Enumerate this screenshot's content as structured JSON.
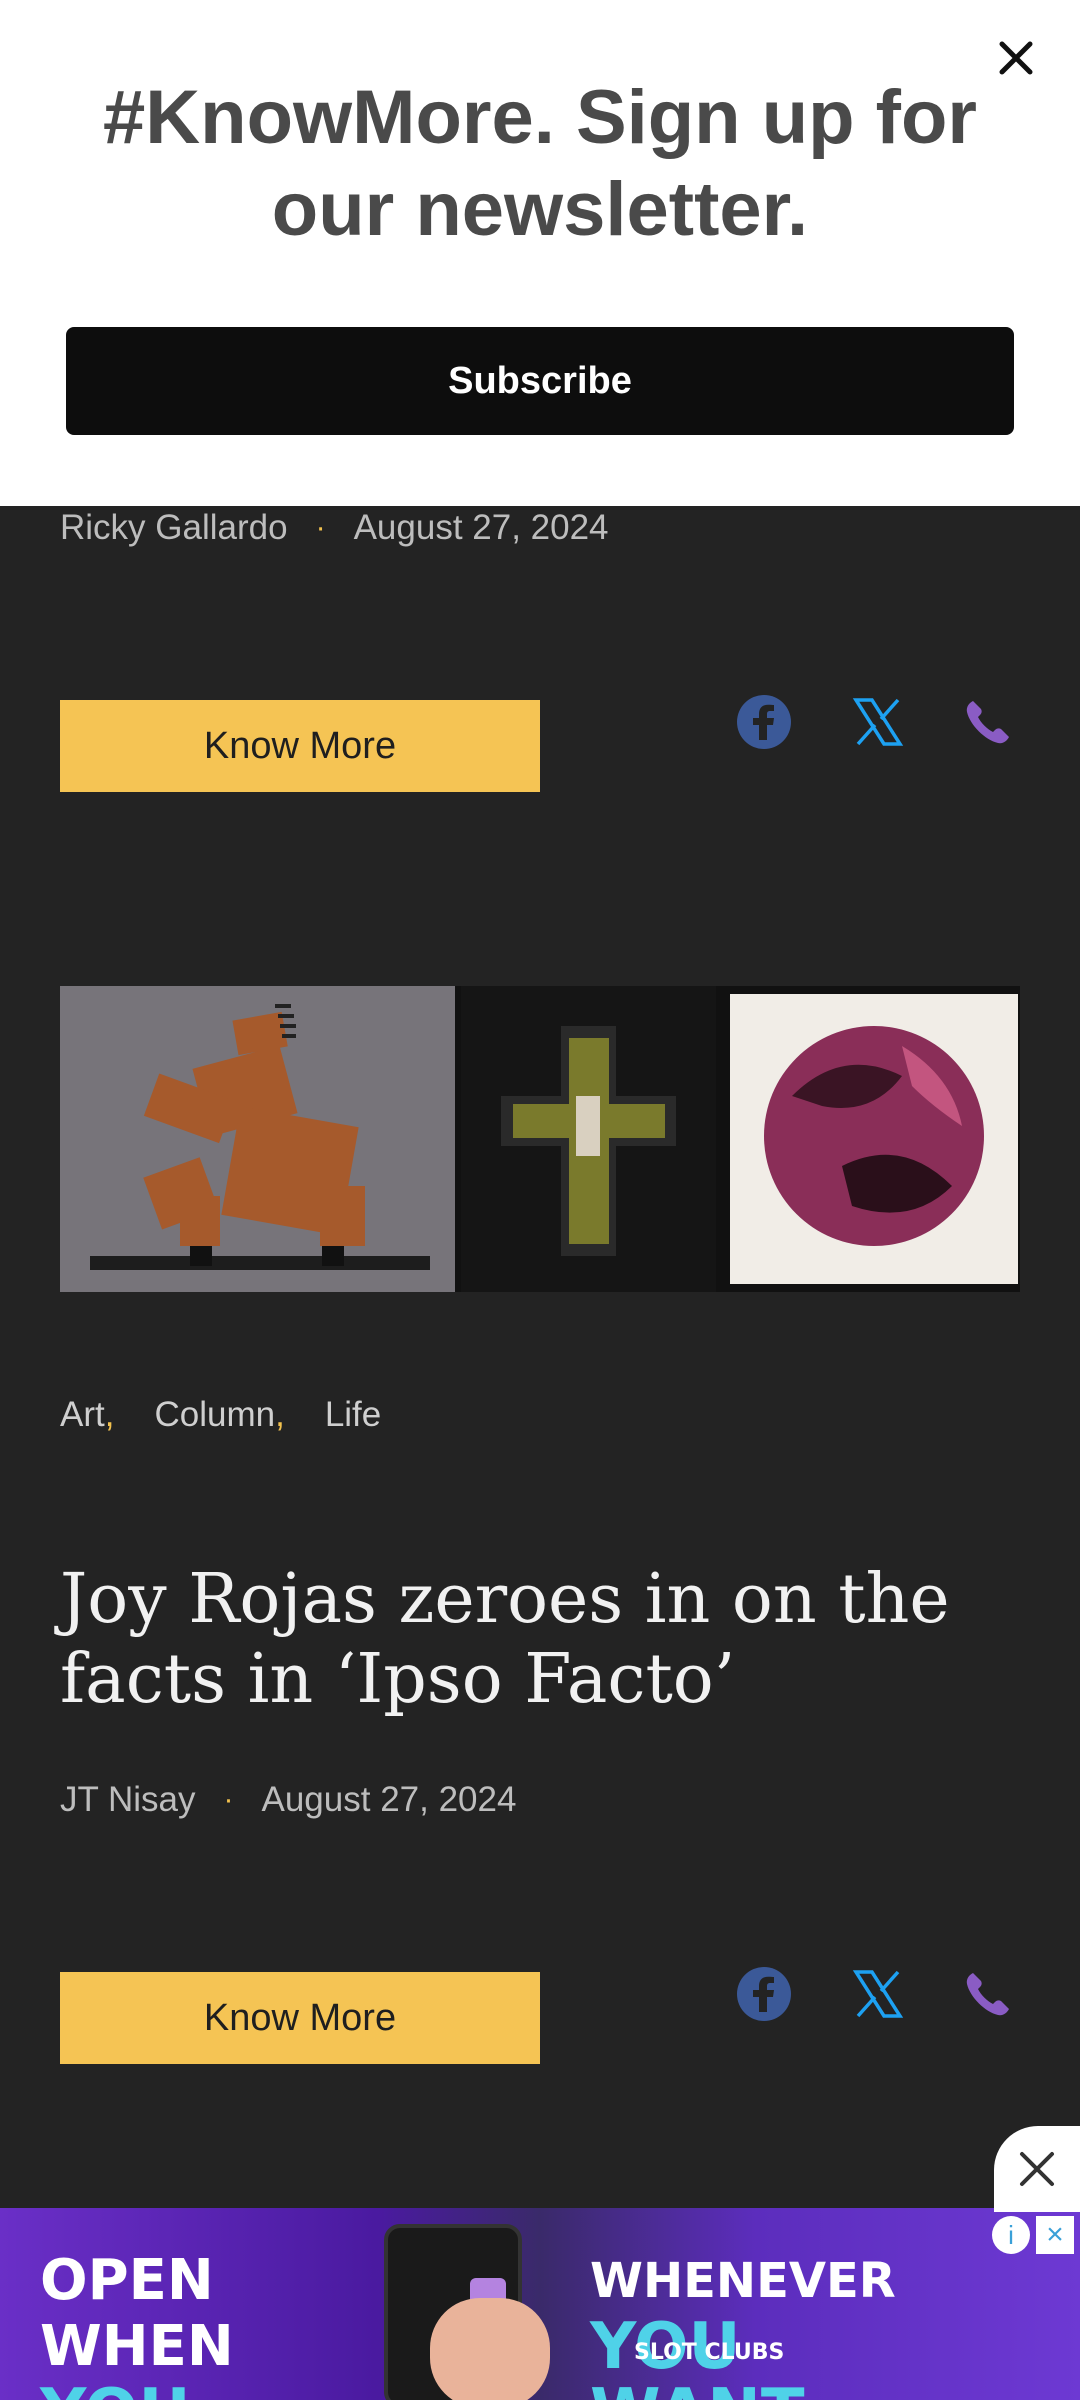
{
  "newsletter": {
    "heading": "#KnowMore. Sign up for our newsletter.",
    "subscribe_label": "Subscribe"
  },
  "article1": {
    "author": "Ricky Gallardo",
    "separator": "·",
    "date": "August 27, 2024",
    "cta_label": "Know More"
  },
  "article2": {
    "categories": [
      "Art",
      "Column",
      "Life"
    ],
    "category_separator": ",",
    "headline": "Joy Rojas zeroes in on the facts in ‘Ipso Facto’",
    "author": "JT Nisay",
    "separator": "·",
    "date": "August 27, 2024",
    "cta_label": "Know More"
  },
  "share_icons": [
    "facebook-icon",
    "x-icon",
    "phone-icon"
  ],
  "ad": {
    "left_line1": "OPEN WHEN",
    "left_line2": "YOU NEED US",
    "right_line1": "WHENEVER",
    "right_line2": "YOU WANT",
    "small_text": "SLOT CLUBS"
  },
  "colors": {
    "accent": "#f5c454",
    "background": "#232323",
    "facebook": "#3b5998",
    "x": "#1da1f2",
    "phone": "#8a5cc4"
  }
}
